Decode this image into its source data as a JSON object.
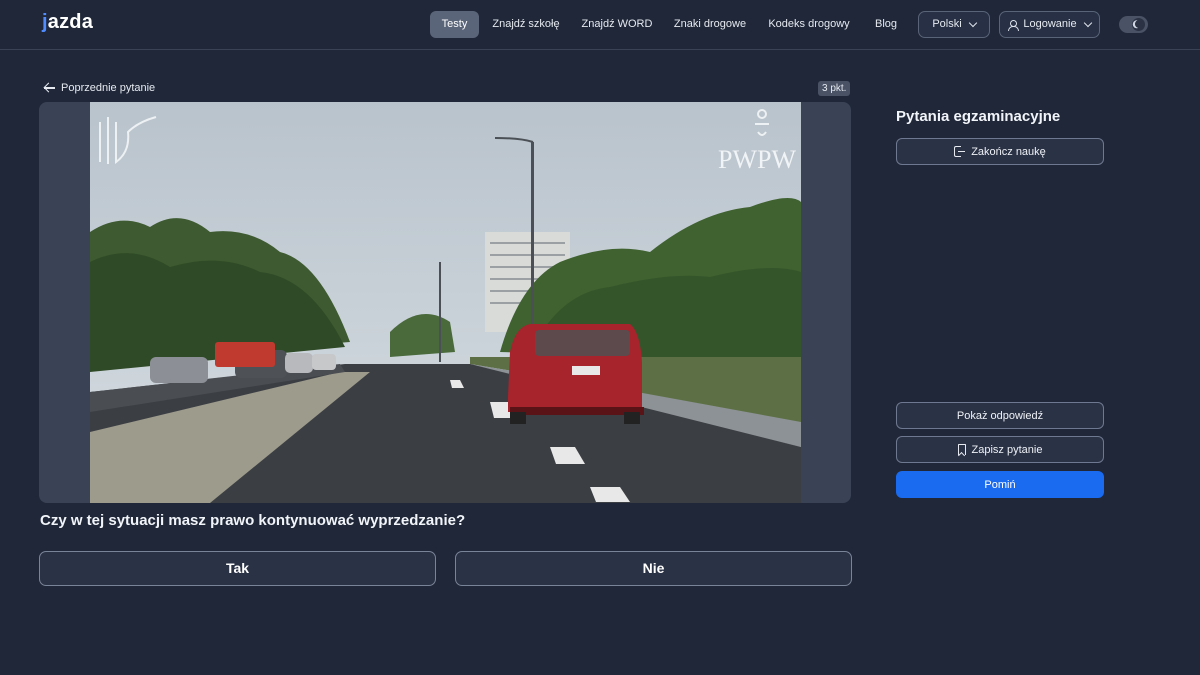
{
  "header": {
    "logo": "jazda",
    "nav": [
      {
        "label": "Testy",
        "active": true
      },
      {
        "label": "Znajdź szkołę",
        "active": false
      },
      {
        "label": "Znajdź WORD",
        "active": false
      },
      {
        "label": "Znaki drogowe",
        "active": false
      },
      {
        "label": "Kodeks drogowy",
        "active": false
      },
      {
        "label": "Blog",
        "active": false
      }
    ],
    "language": "Polski",
    "login": "Logowanie",
    "theme_icon": "moon-icon"
  },
  "question": {
    "back_label": "Poprzednie pytanie",
    "points": "3 pkt.",
    "text": "Czy w tej sytuacji masz prawo kontynuować wyprzedzanie?",
    "answers": [
      "Tak",
      "Nie"
    ],
    "media_watermark": "PWPW"
  },
  "sidebar": {
    "title": "Pytania egzaminacyjne",
    "end_label": "Zakończ naukę",
    "show_answer_label": "Pokaż odpowiedź",
    "save_label": "Zapisz pytanie",
    "skip_label": "Pomiń"
  },
  "colors": {
    "background": "#1f2738",
    "primary": "#1a6bf0",
    "active_nav": "#5b6579"
  }
}
